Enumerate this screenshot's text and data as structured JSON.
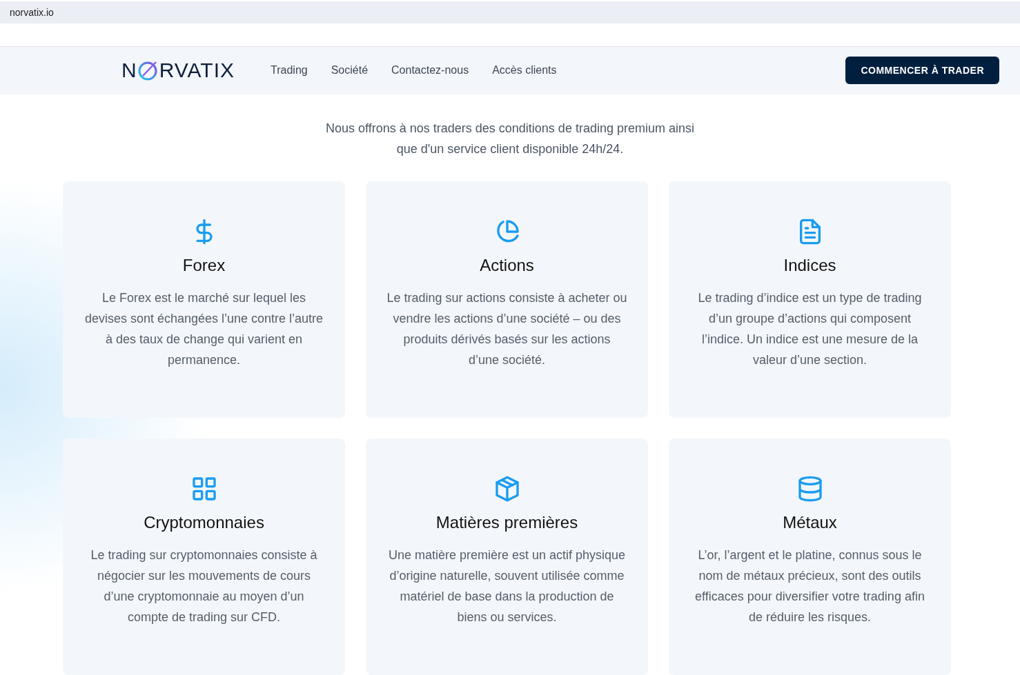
{
  "browser": {
    "address": "norvatix.io"
  },
  "nav": {
    "logo": {
      "before": "N",
      "after": "RVATIX"
    },
    "links": [
      "Trading",
      "Société",
      "Contactez-nous",
      "Accès clients"
    ],
    "cta": "COMMENCER À TRADER"
  },
  "intro": "Nous offrons à nos traders des conditions de trading premium ainsi que d'un service client disponible 24h/24.",
  "products": [
    {
      "kind": "dollar",
      "title": "Forex",
      "text": "Le Forex est le marché sur lequel les devises sont échangées l’une contre l’autre à des taux de change qui varient en permanence."
    },
    {
      "kind": "pie",
      "title": "Actions",
      "text": "Le trading sur actions consiste à acheter ou vendre les actions d’une société – ou des produits dérivés basés sur les actions d’une société."
    },
    {
      "kind": "document",
      "title": "Indices",
      "text": "Le trading d’indice est un type de trading d’un groupe d’actions qui composent l’indice. Un indice est une mesure de la valeur d’une section."
    },
    {
      "kind": "grid",
      "title": "Cryptomonnaies",
      "text": "Le trading sur cryptomonnaies consiste à négocier sur les mouvements de cours d’une cryptomonnaie au moyen d’un compte de trading sur CFD."
    },
    {
      "kind": "box",
      "title": "Matières premières",
      "text": "Une matière première est un actif physique d’origine naturelle, souvent utilisée comme matériel de base dans la production de biens ou services."
    },
    {
      "kind": "database",
      "title": "Métaux",
      "text": "L’or, l’argent et le platine, connus sous le nom de métaux précieux, sont des outils efficaces pour diversifier votre trading afin de réduire les risques."
    }
  ]
}
